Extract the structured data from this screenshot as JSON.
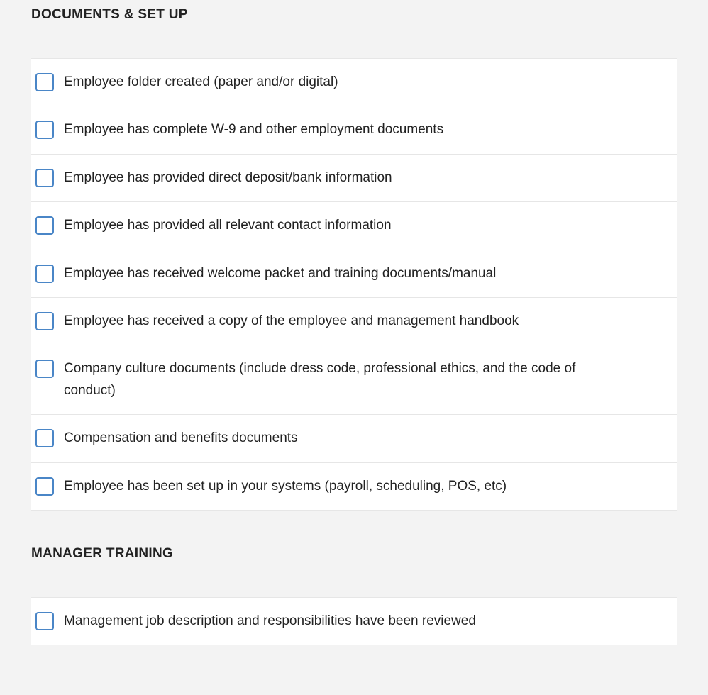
{
  "sections": [
    {
      "title": "DOCUMENTS & SET UP",
      "items": [
        {
          "label": "Employee folder created (paper and/or digital)"
        },
        {
          "label": "Employee has complete W-9 and other employment documents"
        },
        {
          "label": "Employee has provided direct deposit/bank information"
        },
        {
          "label": "Employee has provided all relevant contact information"
        },
        {
          "label": "Employee has received welcome packet and training documents/manual"
        },
        {
          "label": "Employee has received a copy of the employee and management handbook"
        },
        {
          "label": "Company culture documents (include dress code, professional ethics, and the code of conduct)"
        },
        {
          "label": "Compensation and benefits documents"
        },
        {
          "label": "Employee has been set up in your systems (payroll, scheduling, POS, etc)"
        }
      ]
    },
    {
      "title": "MANAGER TRAINING",
      "items": [
        {
          "label": "Management job description and responsibilities have been reviewed"
        }
      ]
    }
  ]
}
